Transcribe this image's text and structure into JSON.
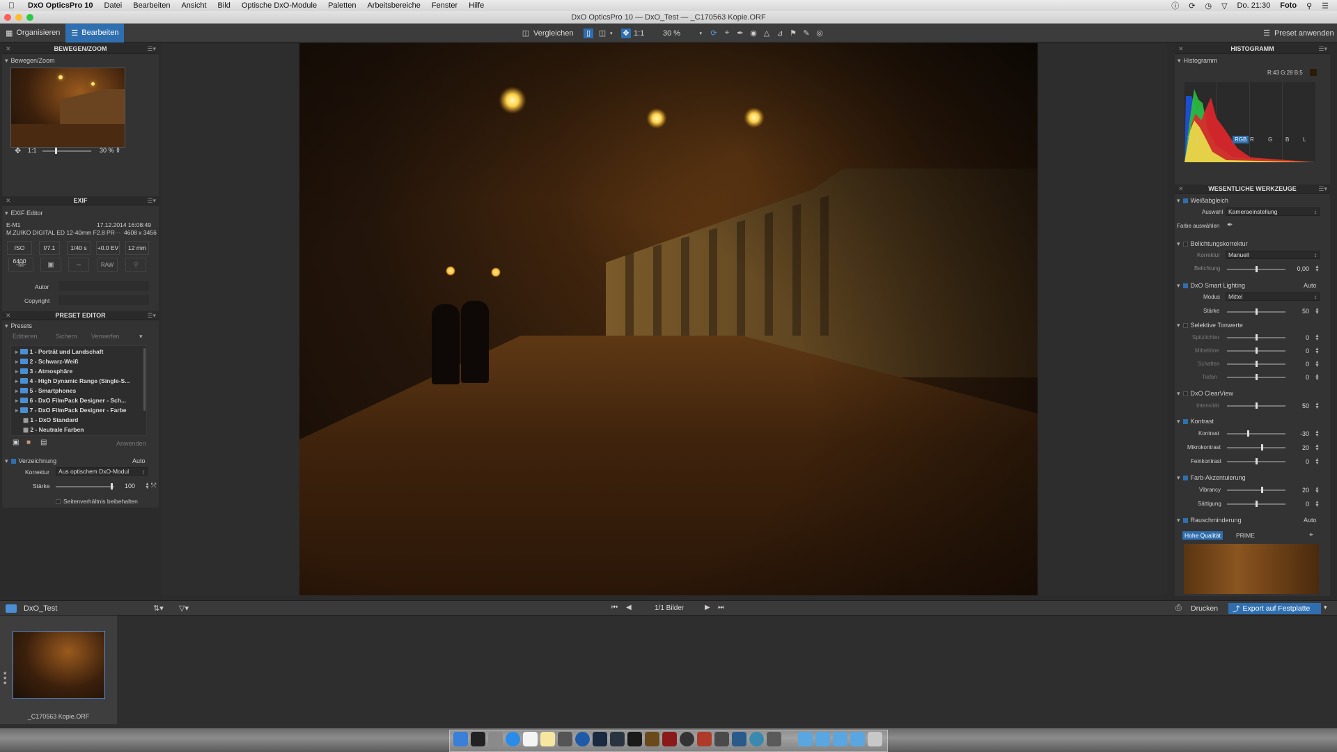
{
  "menubar": {
    "app": "DxO OpticsPro 10",
    "items": [
      "Datei",
      "Bearbeiten",
      "Ansicht",
      "Bild",
      "Optische DxO-Module",
      "Paletten",
      "Arbeitsbereiche",
      "Fenster",
      "Hilfe"
    ],
    "clock": "Do. 21:30",
    "user": "Foto"
  },
  "window": {
    "title": "DxO OpticsPro 10 — DxO_Test — _C170563 Kopie.ORF"
  },
  "toolbar": {
    "tab_organize": "Organisieren",
    "tab_edit": "Bearbeiten",
    "compare": "Vergleichen",
    "ratio": "1:1",
    "zoom": "30 %",
    "preset_apply": "Preset anwenden"
  },
  "left": {
    "move_zoom": {
      "title": "BEWEGEN/ZOOM",
      "sub": "Bewegen/Zoom",
      "ratio": "1:1",
      "zoom": "30 %"
    },
    "exif": {
      "title": "EXIF",
      "sub": "EXIF Editor",
      "camera": "E-M1",
      "date": "17.12.2014 16:08:49",
      "lens": "M.ZUIKO DIGITAL ED 12-40mm F2.8 PR···",
      "size": "4608 x 3456",
      "iso": "ISO 6400",
      "aperture": "f/7.1",
      "shutter": "1/40 s",
      "ev": "+0.0 EV",
      "focal": "12 mm",
      "mode": "-M-",
      "dash": "–",
      "raw": "RAW",
      "author_label": "Autor",
      "copyright_label": "Copyright"
    },
    "preset_editor": {
      "title": "PRESET EDITOR",
      "sub": "Presets",
      "btn_edit": "Editieren",
      "btn_save": "Sichern",
      "btn_discard": "Verwerfen",
      "btn_apply": "Anwenden",
      "items": [
        "1 - Porträt und Landschaft",
        "2 - Schwarz-Weiß",
        "3 - Atmosphäre",
        "4 - High Dynamic Range (Single-S...",
        "5 - Smartphones",
        "6 - DxO FilmPack Designer - Sch...",
        "7 - DxO FilmPack Designer - Farbe",
        "1 - DxO Standard",
        "2 - Neutrale Farben"
      ]
    },
    "distortion": {
      "title": "Verzeichnung",
      "auto": "Auto",
      "korrektur_label": "Korrektur",
      "korrektur_value": "Aus optischem DxO-Modul",
      "staerke_label": "Stärke",
      "staerke_value": "100",
      "keep_ratio": "Seitenverhältnis beibehalten"
    }
  },
  "right": {
    "histogram": {
      "title": "HISTOGRAMM",
      "sub": "Histogramm",
      "readout": "R:43 G:28 B:5",
      "channels": [
        "RGB",
        "R",
        "G",
        "B",
        "L"
      ]
    },
    "tools": {
      "title": "WESENTLICHE WERKZEUGE",
      "wb": {
        "title": "Weißabgleich",
        "auswahl_label": "Auswahl",
        "auswahl_value": "Kameraeinstellung",
        "farbe_label": "Farbe auswählen"
      },
      "exposure": {
        "title": "Belichtungskorrektur",
        "korrektur_label": "Korrektur",
        "korrektur_value": "Manuell",
        "belichtung_label": "Belichtung",
        "belichtung_value": "0,00"
      },
      "smart": {
        "title": "DxO Smart Lighting",
        "auto": "Auto",
        "modus_label": "Modus",
        "modus_value": "Mittel",
        "staerke_label": "Stärke",
        "staerke_value": "50"
      },
      "tones": {
        "title": "Selektive Tonwerte",
        "labels": [
          "Spitzlichter",
          "Mitteltöne",
          "Schatten",
          "Tiefen"
        ],
        "values": [
          "0",
          "0",
          "0",
          "0"
        ]
      },
      "clearview": {
        "title": "DxO ClearView",
        "label": "Intensität",
        "value": "50"
      },
      "contrast": {
        "title": "Kontrast",
        "labels": [
          "Kontrast",
          "Mikrokontrast",
          "Feinkontrast"
        ],
        "values": [
          "-30",
          "20",
          "0"
        ]
      },
      "color": {
        "title": "Farb-Akzentuierung",
        "labels": [
          "Vibrancy",
          "Sättigung"
        ],
        "values": [
          "20",
          "0"
        ]
      },
      "noise": {
        "title": "Rauschminderung",
        "auto": "Auto",
        "hq": "Hohe Qualität",
        "prime": "PRIME"
      }
    }
  },
  "stripbar": {
    "folder": "DxO_Test",
    "count": "1/1 Bilder",
    "print": "Drucken",
    "export": "Export auf Festplatte"
  },
  "thumb": {
    "name": "_C170563 Kopie.ORF"
  }
}
